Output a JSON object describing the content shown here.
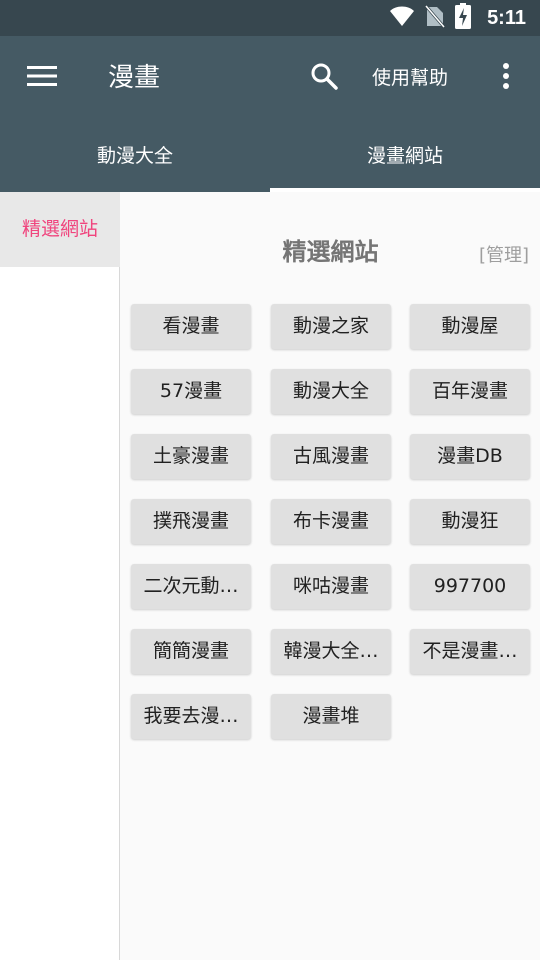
{
  "status_bar": {
    "time": "5:11",
    "icons": [
      "wifi-icon",
      "no-sim-icon",
      "battery-charging-icon"
    ]
  },
  "app_bar": {
    "title": "漫畫",
    "help_label": "使用幫助",
    "icons": [
      "menu-icon",
      "search-icon",
      "more-vert-icon"
    ]
  },
  "tabs": [
    {
      "label": "動漫大全",
      "selected": false
    },
    {
      "label": "漫畫網站",
      "selected": true
    }
  ],
  "colors": {
    "app_bar": "#455a64",
    "status_bar": "#37474f",
    "sidebar_active_text": "#f0457e"
  },
  "sidebar": {
    "items": [
      {
        "label": "精選網站",
        "selected": true
      }
    ]
  },
  "content": {
    "title": "精選網站",
    "manage_label": "[管理]",
    "sites": [
      "看漫畫",
      "動漫之家",
      "動漫屋",
      "57漫畫",
      "動漫大全",
      "百年漫畫",
      "土豪漫畫",
      "古風漫畫",
      "漫畫DB",
      "撲飛漫畫",
      "布卡漫畫",
      "動漫狂",
      "二次元動…",
      "咪咕漫畫",
      "997700",
      "簡簡漫畫",
      "韓漫大全…",
      "不是漫畫…",
      "我要去漫…",
      "漫畫堆"
    ]
  }
}
